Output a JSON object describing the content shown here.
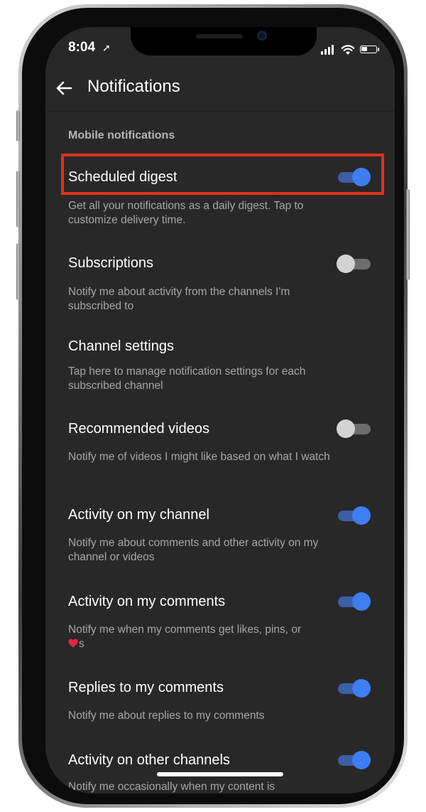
{
  "status_bar": {
    "time": "8:04",
    "location_arrow": "➚"
  },
  "header": {
    "title": "Notifications"
  },
  "section": {
    "title": "Mobile notifications"
  },
  "settings": [
    {
      "title": "Scheduled digest",
      "desc": "Get all your notifications as a daily digest. Tap to customize delivery time.",
      "toggle": "on",
      "highlighted": true
    },
    {
      "title": "Subscriptions",
      "desc": "Notify me about activity from the channels I'm subscribed to",
      "toggle": "off"
    },
    {
      "title": "Channel settings",
      "desc": "Tap here to manage notification settings for each subscribed channel",
      "toggle": "none"
    },
    {
      "title": "Recommended videos",
      "desc": "Notify me of videos I might like based on what I watch",
      "toggle": "off"
    },
    {
      "title": "Activity on my channel",
      "desc": "Notify me about comments and other activity on my channel or videos",
      "toggle": "on"
    },
    {
      "title": "Activity on my comments",
      "desc": "Notify me when my comments get likes, pins, or",
      "desc_suffix": "s",
      "toggle": "on"
    },
    {
      "title": "Replies to my comments",
      "desc": "Notify me about replies to my comments",
      "toggle": "on"
    },
    {
      "title": "Activity on other channels",
      "desc": "Notify me occasionally when my content is",
      "toggle": "on"
    }
  ],
  "icons": {
    "back": "arrow-left-icon",
    "heart": "heart-emoji-icon",
    "location": "location-arrow-icon",
    "signal": "cellular-signal-icon",
    "wifi": "wifi-icon",
    "battery": "battery-icon"
  },
  "colors": {
    "background": "#282828",
    "toggle_on": "#3f7df2",
    "toggle_off": "#d3d3d3",
    "highlight": "#e2301d",
    "heart": "#e0284a"
  }
}
